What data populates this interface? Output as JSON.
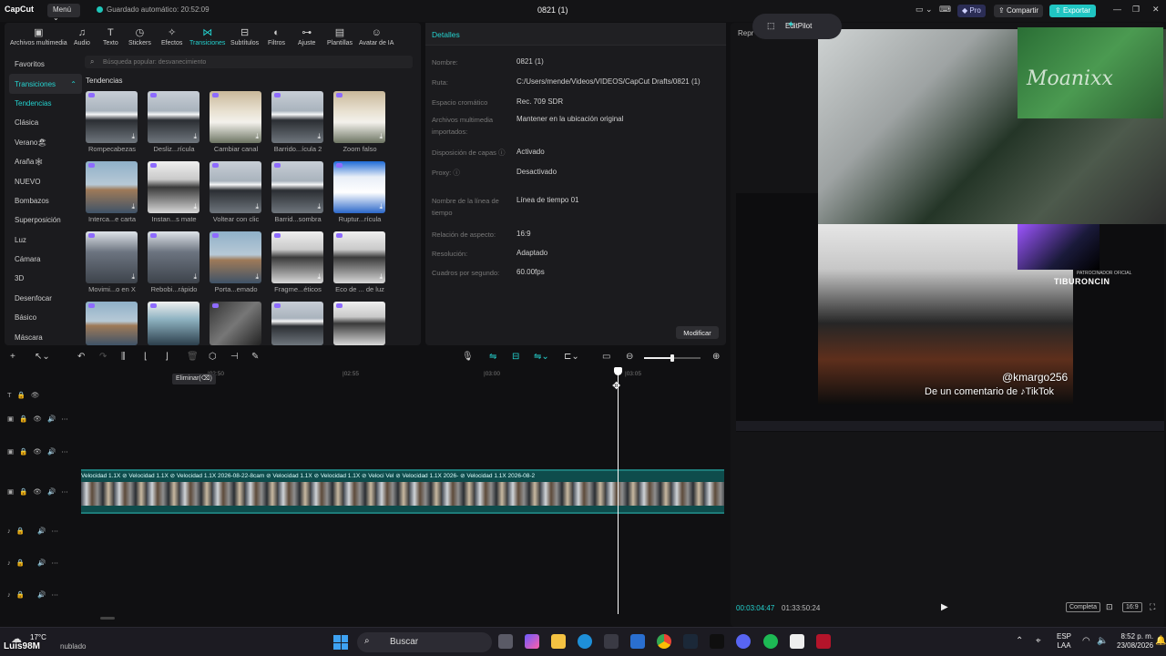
{
  "app": {
    "logo": "CapCut",
    "menu_label": "Menú",
    "autosave": "Guardado automático: 20:52:09",
    "project_title": "0821 (1)",
    "pro_label": "Pro",
    "share_label": "Compartir",
    "export_label": "Exportar"
  },
  "tool_tabs": [
    {
      "label": "Archivos multimedia",
      "icon": "media-icon"
    },
    {
      "label": "Audio",
      "icon": "audio-icon"
    },
    {
      "label": "Texto",
      "icon": "text-icon"
    },
    {
      "label": "Stickers",
      "icon": "sticker-icon"
    },
    {
      "label": "Efectos",
      "icon": "effects-icon"
    },
    {
      "label": "Transiciones",
      "icon": "transitions-icon"
    },
    {
      "label": "Subtítulos",
      "icon": "subtitles-icon"
    },
    {
      "label": "Filtros",
      "icon": "filters-icon"
    },
    {
      "label": "Ajuste",
      "icon": "adjust-icon"
    },
    {
      "label": "Plantillas",
      "icon": "templates-icon"
    },
    {
      "label": "Avatar de IA",
      "icon": "avatar-icon"
    }
  ],
  "categories": [
    "Favoritos",
    "Transiciones",
    "Tendencias",
    "Clásica",
    "Verano🏖",
    "Araña🕸",
    "NUEVO",
    "Bombazos",
    "Superposición",
    "Luz",
    "Cámara",
    "3D",
    "Desenfocar",
    "Básico",
    "Máscara"
  ],
  "search_placeholder": "Búsqueda popular: desvanecimiento",
  "section_title": "Tendencias",
  "transitions": [
    {
      "label": "Rompecabezas",
      "style": "mt"
    },
    {
      "label": "Desliz...rícula",
      "style": "mt"
    },
    {
      "label": "Cambiar canal",
      "style": "wm"
    },
    {
      "label": "Barrido...ícula 2",
      "style": "mt"
    },
    {
      "label": "Zoom falso",
      "style": "wm"
    },
    {
      "label": "Interca...e carta",
      "style": "tw"
    },
    {
      "label": "Instan...s mate",
      "style": "pp"
    },
    {
      "label": "Voltear con clic",
      "style": "mt"
    },
    {
      "label": "Barrid...sombra",
      "style": "mt"
    },
    {
      "label": "Ruptur...rícula",
      "style": "bw"
    },
    {
      "label": "Movimi...o en X",
      "style": "ny"
    },
    {
      "label": "Rebobi...rápido",
      "style": "ny"
    },
    {
      "label": "Porta...emado",
      "style": "tw"
    },
    {
      "label": "Fragme...éticos",
      "style": "pp"
    },
    {
      "label": "Eco de ... de luz",
      "style": "pp"
    },
    {
      "label": "",
      "style": "tw"
    },
    {
      "label": "",
      "style": "hm"
    },
    {
      "label": "",
      "style": "dk"
    },
    {
      "label": "",
      "style": "mt"
    },
    {
      "label": "",
      "style": "pp"
    }
  ],
  "details": {
    "header": "Detalles",
    "rows": [
      {
        "label": "Nombre:",
        "value": "0821 (1)"
      },
      {
        "label": "Ruta:",
        "value": "C:/Users/mende/Videos/VIDEOS/CapCut Drafts/0821 (1)"
      },
      {
        "label": "Espacio cromático",
        "value": "Rec. 709 SDR"
      },
      {
        "label": "Archivos multimedia importados:",
        "value": "Mantener en la ubicación original"
      },
      {
        "label": "Disposición de capas ⓘ",
        "value": "Activado"
      },
      {
        "label": "Proxy: ⓘ",
        "value": "Desactivado"
      },
      {
        "label": "Nombre de la línea de tiempo",
        "value": "Línea de tiempo 01"
      },
      {
        "label": "Relación de aspecto:",
        "value": "16:9"
      },
      {
        "label": "Resolución:",
        "value": "Adaptado"
      },
      {
        "label": "Cuadros por segundo:",
        "value": "60.00fps"
      }
    ],
    "modify_label": "Modificar"
  },
  "player": {
    "header": "Repr",
    "editpilot_label": "EditPilot",
    "overlay_name": "@kmargo256",
    "overlay_caption": "De un comentario de ♪TikTok",
    "sponsor": "TIBURONCIN",
    "sponsor_small": "PATROCINADOR OFICIAL",
    "green_wall_text": "Moanixx",
    "current_time": "00:03:04:47",
    "total_time": "01:33:50:24",
    "complete_label": "Completa",
    "ratio_label": "16:9"
  },
  "timeline": {
    "tooltip": "Eliminar(⌫)",
    "ruler_ticks": [
      "|02:50",
      "|02:55",
      "|03:00",
      "|03:05"
    ],
    "clip_labels": "Velocidad 1.1X  ⊘  Velocidad 1.1X  ⊘  Velocidad 1.1X  2026-08-22-8cam  ⊘  Velocidad 1.1X  ⊘  Velocidad 1.1X  ⊘  Veloci  Vel  ⊘  Velocidad 1.1X  2026-  ⊘  Velocidad 1.1X  2026-08-2"
  },
  "taskbar": {
    "temperature": "17°C",
    "weather": "nublado",
    "search_label": "Buscar",
    "lang": "ESP",
    "layout": "LAA",
    "time": "8:52 p. m.",
    "date": "23/08/2026"
  },
  "watermark_user": "Luis98M",
  "colors": {
    "accent": "#24d2cf",
    "export": "#20c5c2",
    "clip": "#0e4c4c"
  }
}
